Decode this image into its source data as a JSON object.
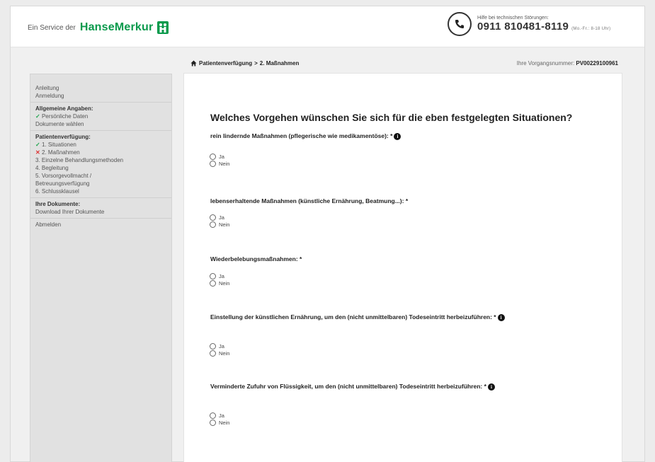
{
  "header": {
    "service_prefix": "Ein Service der",
    "brand_name": "HanseMerkur",
    "hotline_label": "Hilfe bei technischen Störungen:",
    "hotline_number": "0911 810481-8119",
    "hotline_hours": "(Mo.-Fr.: 8-18 Uhr)"
  },
  "breadcrumb": {
    "home": "Patientenverfügung",
    "sep": ">",
    "current": "2. Maßnahmen"
  },
  "vorgang": {
    "label": "Ihre Vorgangsnummer:",
    "number": "PV00229100961"
  },
  "sidebar": {
    "anleitung": "Anleitung",
    "anmeldung": "Anmeldung",
    "allgemein_head": "Allgemeine Angaben:",
    "persoenliche": "Persönliche Daten",
    "dokumente_waehlen": "Dokumente wählen",
    "pv_head": "Patientenverfügung:",
    "situationen": "1. Situationen",
    "massnahmen": "2. Maßnahmen",
    "behandlung": "3. Einzelne Behandlungsmethoden",
    "begleitung": "4. Begleitung",
    "vorsorge1": "5. Vorsorgevollmacht /",
    "vorsorge2": "Betreuungsverfügung",
    "schluss": "6. Schlussklausel",
    "dok_head": "Ihre Dokumente:",
    "download": "Download Ihrer Dokumente",
    "abmelden": "Abmelden"
  },
  "main": {
    "title": "Welches Vorgehen wünschen Sie sich für die eben festgelegten Situationen?",
    "q1": "rein lindernde Maßnahmen (pflegerische wie medikamentöse): *",
    "q2": "lebenserhaltende Maßnahmen (künstliche Ernährung, Beatmung...): *",
    "q3": "Wiederbelebungsmaßnahmen: *",
    "q4": "Einstellung der künstlichen Ernährung, um den (nicht unmittelbaren) Todeseintritt herbeizuführen: *",
    "q5": "Verminderte Zufuhr von Flüssigkeit, um den (nicht unmittelbaren) Todeseintritt herbeizuführen: *",
    "opt_yes": "Ja",
    "opt_no": "Nein",
    "info_glyph": "i"
  },
  "colors": {
    "brand_green": "#0a9a4c",
    "check_green": "#1aa34a",
    "cross_red": "#d33"
  }
}
